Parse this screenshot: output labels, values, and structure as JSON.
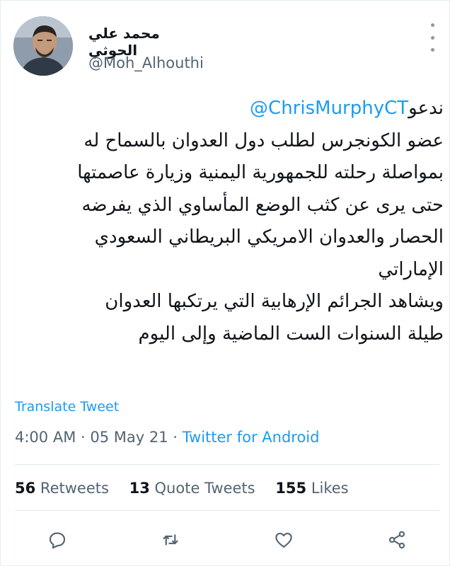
{
  "tweet": {
    "author": {
      "display_name": "محمد علي الحوثي",
      "handle": "@Moh_Alhouthi"
    },
    "mention": "@ChrisMurphyCT",
    "lines": [
      "ندعو",
      "عضو الكونجرس لطلب دول العدوان بالسماح له",
      "بمواصلة رحلته للجمهورية اليمنية وزيارة عاصمتها",
      "حتى يرى عن كثب الوضع المأساوي الذي يفرضه",
      "الحصار والعدوان الامريكي البريطاني السعودي",
      "الإماراتي",
      "ويشاهد الجرائم الإرهابية التي يرتكبها العدوان",
      "طيلة السنوات الست الماضية وإلى اليوم"
    ],
    "translate_label": "Translate Tweet",
    "time": "4:00 AM",
    "date": "05 May 21",
    "separator": "·",
    "source": "Twitter for Android"
  },
  "stats": {
    "retweets_count": "56",
    "retweets_label": "Retweets",
    "quote_count": "13",
    "quote_label": "Quote Tweets",
    "likes_count": "155",
    "likes_label": "Likes"
  },
  "icons": {
    "reply": "speech-bubble-icon",
    "retweet": "retweet-arrows-icon",
    "like": "heart-icon",
    "share": "share-nodes-icon",
    "more": "vertical-dots-icon"
  },
  "colors": {
    "link": "#1d9bf0",
    "muted": "#536471",
    "text": "#0f1419"
  }
}
